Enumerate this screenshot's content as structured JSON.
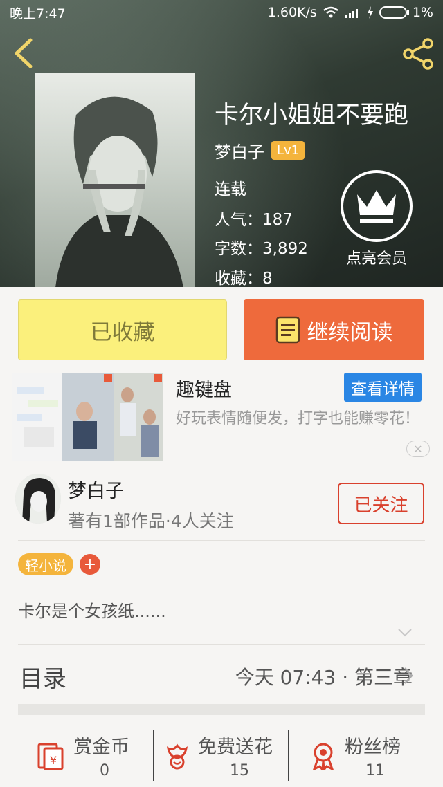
{
  "status_bar": {
    "time": "晚上7:47",
    "speed": "1.60K/s",
    "battery": "1%"
  },
  "book": {
    "title": "卡尔小姐姐不要跑",
    "author": "梦白子",
    "level": "Lv1",
    "status": "连载",
    "popularity": "人气：187",
    "word_count": "字数：3,892",
    "favorites": "收藏：8"
  },
  "vip": {
    "label": "点亮会员",
    "icon": "crown-icon"
  },
  "actions": {
    "collected_label": "已收藏",
    "continue_label": "继续阅读"
  },
  "ad": {
    "title": "趣键盘",
    "detail_button": "查看详情",
    "description": "好玩表情随便发，打字也能赚零花！",
    "close": "✕"
  },
  "author_card": {
    "name": "梦白子",
    "stats": "著有1部作品·4人关注",
    "follow_label": "已关注"
  },
  "tags": {
    "items": [
      "轻小说"
    ],
    "add": "+"
  },
  "summary": "卡尔是个女孩纸......",
  "toc": {
    "label": "目录",
    "latest": "今天 07:43 · 第三章"
  },
  "bottom_bar": {
    "items": [
      {
        "label": "赏金币",
        "count": "0",
        "icon": "red-envelope-icon"
      },
      {
        "label": "免费送花",
        "count": "15",
        "icon": "flower-icon"
      },
      {
        "label": "粉丝榜",
        "count": "11",
        "icon": "medal-icon"
      }
    ]
  },
  "colors": {
    "accent_orange": "#ee6a3c",
    "collected_yellow": "#fbf07c",
    "level_badge": "#f4b43c",
    "follow_red": "#d9412d",
    "ad_button_blue": "#2a86e4"
  }
}
